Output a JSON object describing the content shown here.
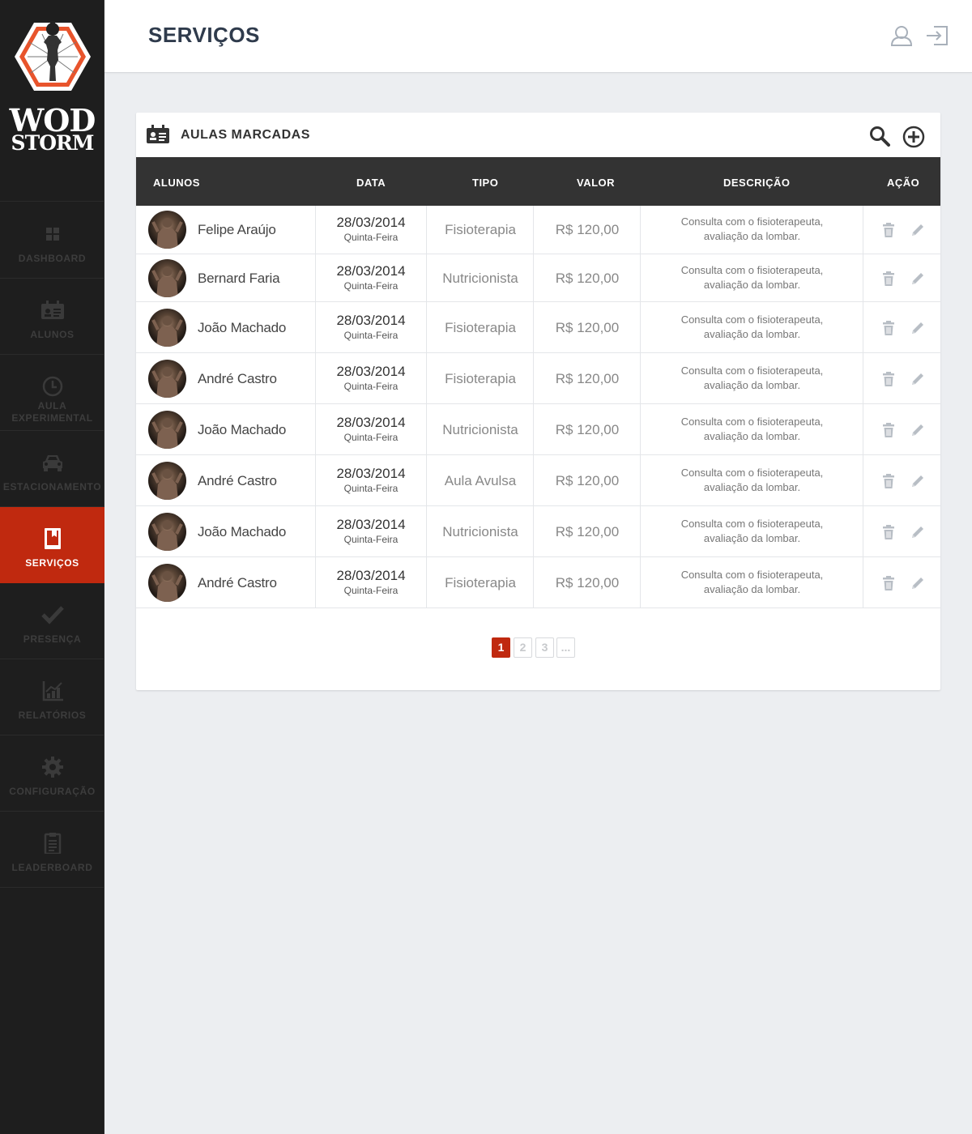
{
  "brand": {
    "line1": "WOD",
    "line2": "STORM"
  },
  "sidebar": {
    "items": [
      {
        "label": "DASHBOARD",
        "icon": "grid-icon"
      },
      {
        "label": "ALUNOS",
        "icon": "id-card-icon"
      },
      {
        "label": "AULA EXPERIMENTAL",
        "icon": "clock-icon"
      },
      {
        "label": "ESTACIONAMENTO",
        "icon": "car-icon"
      },
      {
        "label": "SERVIÇOS",
        "icon": "book-icon",
        "active": true
      },
      {
        "label": "PRESENÇA",
        "icon": "check-icon"
      },
      {
        "label": "RELATÓRIOS",
        "icon": "chart-icon"
      },
      {
        "label": "CONFIGURAÇÃO",
        "icon": "gear-icon"
      },
      {
        "label": "LEADERBOARD",
        "icon": "clipboard-icon"
      }
    ]
  },
  "header": {
    "title": "SERVIÇOS"
  },
  "panel": {
    "title": "AULAS MARCADAS",
    "columns": [
      "ALUNOS",
      "DATA",
      "TIPO",
      "VALOR",
      "DESCRIÇÃO",
      "AÇÃO"
    ],
    "rows": [
      {
        "name": "Felipe Araújo",
        "date": "28/03/2014",
        "weekday": "Quinta-Feira",
        "tipo": "Fisioterapia",
        "valor": "R$ 120,00",
        "desc1": "Consulta com o fisioterapeuta,",
        "desc2": "avaliação da lombar."
      },
      {
        "name": "Bernard Faria",
        "date": "28/03/2014",
        "weekday": "Quinta-Feira",
        "tipo": "Nutricionista",
        "valor": "R$ 120,00",
        "desc1": "Consulta com o fisioterapeuta,",
        "desc2": "avaliação da lombar."
      },
      {
        "name": "João Machado",
        "date": "28/03/2014",
        "weekday": "Quinta-Feira",
        "tipo": "Fisioterapia",
        "valor": "R$ 120,00",
        "desc1": "Consulta com o fisioterapeuta,",
        "desc2": "avaliação da lombar."
      },
      {
        "name": "André Castro",
        "date": "28/03/2014",
        "weekday": "Quinta-Feira",
        "tipo": "Fisioterapia",
        "valor": "R$ 120,00",
        "desc1": "Consulta com o fisioterapeuta,",
        "desc2": "avaliação da lombar."
      },
      {
        "name": "João Machado",
        "date": "28/03/2014",
        "weekday": "Quinta-Feira",
        "tipo": "Nutricionista",
        "valor": "R$ 120,00",
        "desc1": "Consulta com o fisioterapeuta,",
        "desc2": "avaliação da lombar."
      },
      {
        "name": "André Castro",
        "date": "28/03/2014",
        "weekday": "Quinta-Feira",
        "tipo": "Aula Avulsa",
        "valor": "R$ 120,00",
        "desc1": "Consulta com o fisioterapeuta,",
        "desc2": "avaliação da lombar."
      },
      {
        "name": "João Machado",
        "date": "28/03/2014",
        "weekday": "Quinta-Feira",
        "tipo": "Nutricionista",
        "valor": "R$ 120,00",
        "desc1": "Consulta com o fisioterapeuta,",
        "desc2": "avaliação da lombar."
      },
      {
        "name": "André Castro",
        "date": "28/03/2014",
        "weekday": "Quinta-Feira",
        "tipo": "Fisioterapia",
        "valor": "R$ 120,00",
        "desc1": "Consulta com o fisioterapeuta,",
        "desc2": "avaliação da lombar."
      }
    ]
  },
  "pagination": {
    "pages": [
      "1",
      "2",
      "3",
      "..."
    ],
    "current": "1"
  },
  "colors": {
    "accent": "#c0290f",
    "sidebar": "#1e1e1e",
    "table_header": "#333333",
    "background": "#eceef1"
  }
}
